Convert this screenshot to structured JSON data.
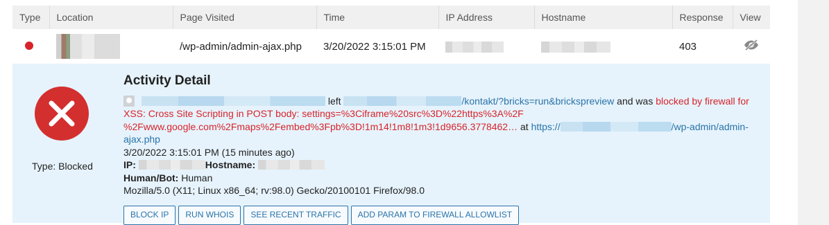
{
  "columns": {
    "type": "Type",
    "location": "Location",
    "page_visited": "Page Visited",
    "time": "Time",
    "ip_address": "IP Address",
    "hostname": "Hostname",
    "response": "Response",
    "view": "View"
  },
  "row": {
    "status_color": "#d8232a",
    "page_visited": "/wp-admin/admin-ajax.php",
    "time": "3/20/2022 3:15:01 PM",
    "response": "403",
    "view_icon": "eye-slash-icon"
  },
  "detail": {
    "title": "Activity Detail",
    "type_label": "Type: Blocked",
    "left_word": "left",
    "url_path": "/kontakt/?bricks=run&brickspreview",
    "and_was": "and was",
    "blocked_msg": "blocked by firewall for",
    "xss_line1": "XSS: Cross Site Scripting in POST body: settings=%3Ciframe%20src%3D%22https%3A%2F",
    "xss_line2": "%2Fwww.google.com%2Fmaps%2Fembed%3Fpb%3D!1m14!1m8!1m3!1d9656.3778462…",
    "at_word": "at",
    "at_url_prefix": "https://",
    "at_url_path": "/wp-admin/admin-ajax.php",
    "timestamp": "3/20/2022 3:15:01 PM (15 minutes ago)",
    "ip_label": "IP:",
    "hostname_label": "Hostname:",
    "human_bot_label": "Human/Bot:",
    "human_bot_value": "Human",
    "user_agent": "Mozilla/5.0 (X11; Linux x86_64; rv:98.0) Gecko/20100101 Firefox/98.0"
  },
  "buttons": {
    "block_ip": "Block IP",
    "run_whois": "Run WHOIS",
    "see_recent_traffic": "See Recent Traffic",
    "add_param": "Add Param to Firewall Allowlist"
  },
  "colors": {
    "accent": "#2a73a8",
    "blocked_red": "#d8232a",
    "detail_bg": "#e6f3fc"
  }
}
